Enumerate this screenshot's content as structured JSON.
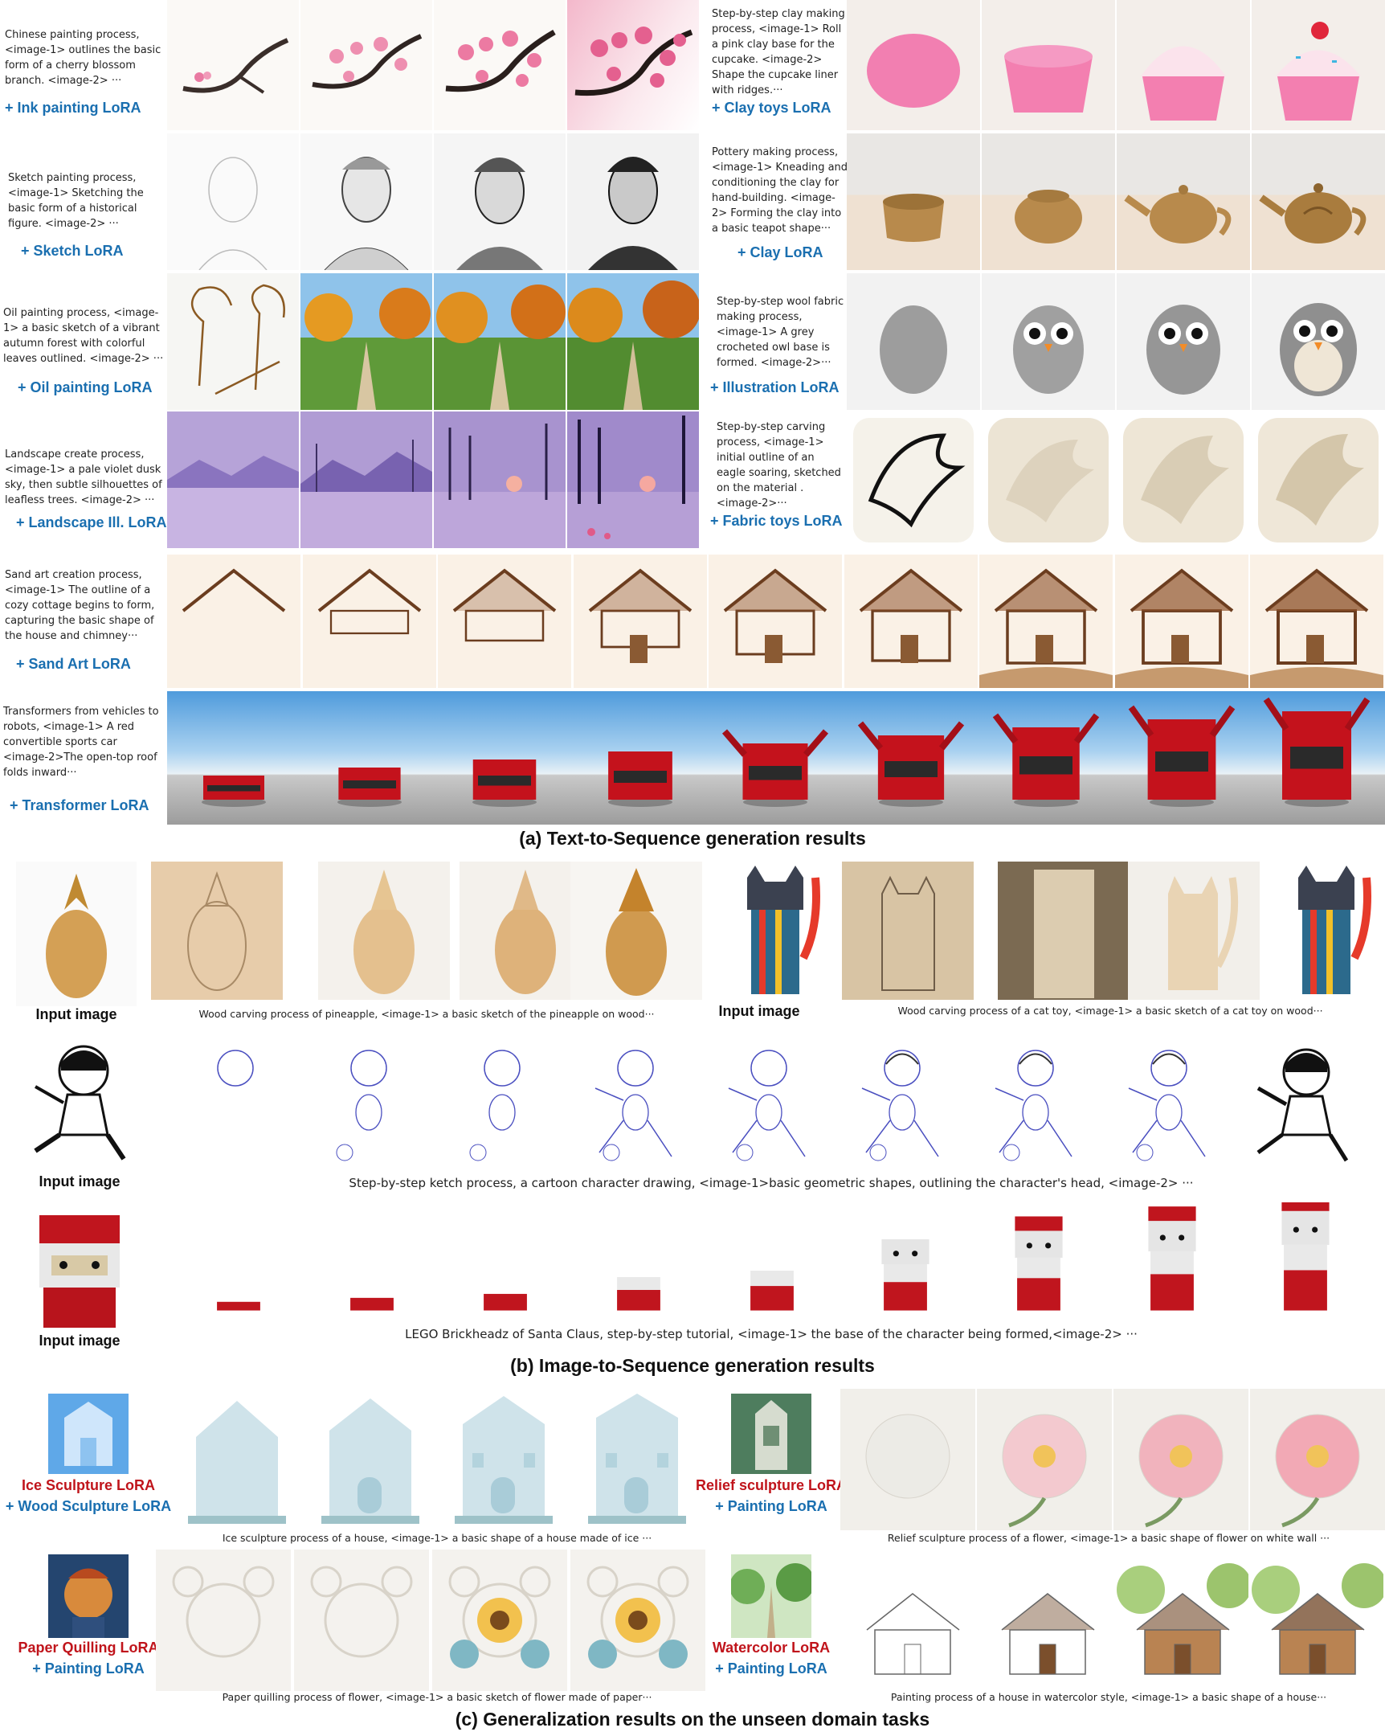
{
  "section_a": {
    "caption": "(a) Text-to-Sequence generation results",
    "rows": [
      {
        "prompt": "Chinese painting process, <image-1> outlines the basic form of a cherry blossom branch. <image-2> ···",
        "lora": "+ Ink painting LoRA"
      },
      {
        "prompt": "Step-by-step clay making process, <image-1> Roll a pink clay base for the cupcake. <image-2> Shape the cupcake liner with ridges.···",
        "lora": "+ Clay toys LoRA"
      },
      {
        "prompt": "Sketch painting process, <image-1> Sketching the basic form of a historical figure. <image-2> ···",
        "lora": "+ Sketch LoRA"
      },
      {
        "prompt": "Pottery making process, <image-1> Kneading and conditioning the clay for hand-building. <image-2> Forming the clay into a basic teapot shape···",
        "lora": "+ Clay LoRA"
      },
      {
        "prompt": "Oil painting process, <image-1> a basic sketch of a vibrant autumn forest with colorful leaves outlined. <image-2> ···",
        "lora": "+ Oil painting LoRA"
      },
      {
        "prompt": "Step-by-step wool fabric making process, <image-1> A grey crocheted owl base is formed. <image-2>···",
        "lora": "+ Illustration LoRA"
      },
      {
        "prompt": "Landscape create process, <image-1> a pale violet dusk sky, then subtle silhouettes of leafless trees. <image-2> ···",
        "lora": "+ Landscape Ill.  LoRA"
      },
      {
        "prompt": "Step-by-step carving process, <image-1> initial outline of an eagle soaring, sketched on the material . <image-2>···",
        "lora": "+ Fabric toys LoRA"
      },
      {
        "prompt": "Sand art creation process, <image-1> The outline of a cozy cottage begins to form, capturing the basic shape of the house and chimney···",
        "lora": "+ Sand Art LoRA"
      },
      {
        "prompt": "Transformers from vehicles to robots, <image-1> A red convertible sports car <image-2>The open-top roof folds inward···",
        "lora": "+ Transformer LoRA"
      }
    ]
  },
  "section_b": {
    "caption": "(b) Image-to-Sequence generation results",
    "input_label": "Input image",
    "prompts": [
      "Wood carving process of pineapple, <image-1> a basic sketch of the pineapple on wood···",
      "Wood carving process of a cat toy, <image-1> a basic sketch of a cat toy on wood···",
      "Step-by-step ketch process, a cartoon character drawing, <image-1>basic geometric shapes, outlining the character's head, <image-2> ···",
      "LEGO Brickheadz of Santa Claus,  step-by-step tutorial, <image-1> the base of the character being formed,<image-2> ···"
    ]
  },
  "section_c": {
    "caption": "(c) Generalization results on the unseen domain tasks",
    "blocks": [
      {
        "lora_red": "Ice Sculpture LoRA",
        "lora_blue": "+ Wood Sculpture LoRA",
        "prompt": "Ice sculpture process of a house, <image-1> a basic shape of a house made of ice ···"
      },
      {
        "lora_red": "Relief sculpture LoRA",
        "lora_blue": "+ Painting LoRA",
        "prompt": "Relief sculpture process of a flower, <image-1> a basic shape of flower on white wall ···"
      },
      {
        "lora_red": "Paper Quilling LoRA",
        "lora_blue": "+ Painting LoRA",
        "prompt": "Paper quilling process of flower, <image-1> a basic sketch of flower made of paper···"
      },
      {
        "lora_red": "Watercolor LoRA",
        "lora_blue": "+ Painting LoRA",
        "prompt": "Painting process of a house in watercolor style, <image-1> a basic shape of a house···"
      }
    ]
  }
}
